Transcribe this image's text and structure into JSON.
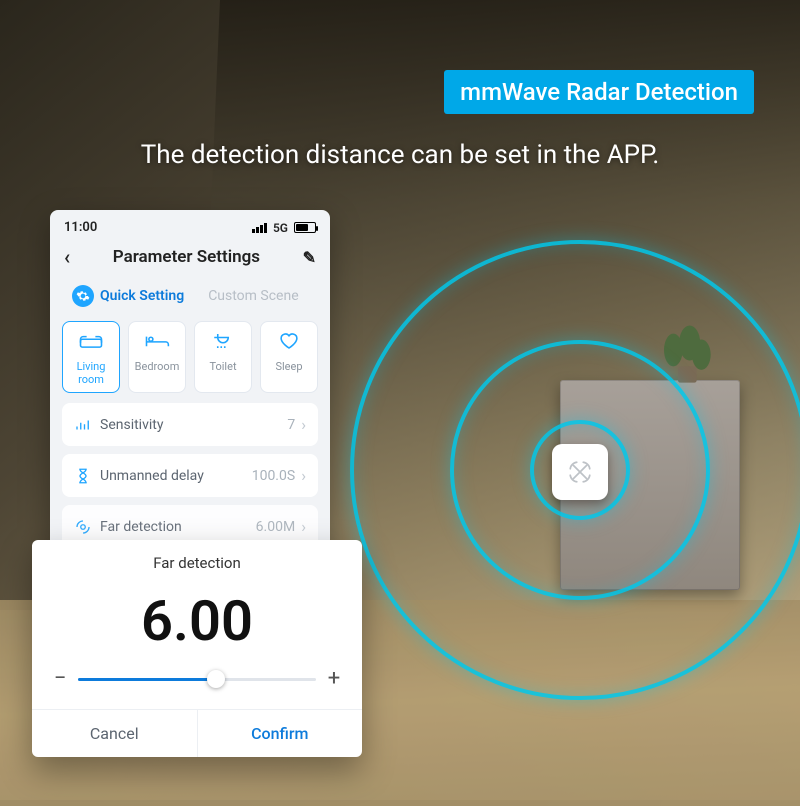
{
  "badge": "mmWave Radar Detection",
  "headline": "The detection distance can be set in the APP.",
  "statusbar": {
    "time": "11:00",
    "network": "5G"
  },
  "app": {
    "title": "Parameter Settings",
    "tabs": {
      "quick": "Quick Setting",
      "custom": "Custom Scene"
    },
    "scenes": [
      {
        "key": "living",
        "label": "Living room"
      },
      {
        "key": "bedroom",
        "label": "Bedroom"
      },
      {
        "key": "toilet",
        "label": "Toilet"
      },
      {
        "key": "sleep",
        "label": "Sleep"
      }
    ],
    "settings": {
      "sensitivity": {
        "label": "Sensitivity",
        "value": "7"
      },
      "unmanned": {
        "label": "Unmanned delay",
        "value": "100.0S"
      },
      "far": {
        "label": "Far detection",
        "value": "6.00M"
      }
    }
  },
  "popup": {
    "title": "Far detection",
    "value": "6.00",
    "minus": "−",
    "plus": "+",
    "cancel": "Cancel",
    "confirm": "Confirm",
    "percent": 58
  },
  "colors": {
    "accent_cyan": "#00c8eb",
    "accent_blue": "#0d7bdb",
    "badge_bg": "#00a8e8"
  }
}
